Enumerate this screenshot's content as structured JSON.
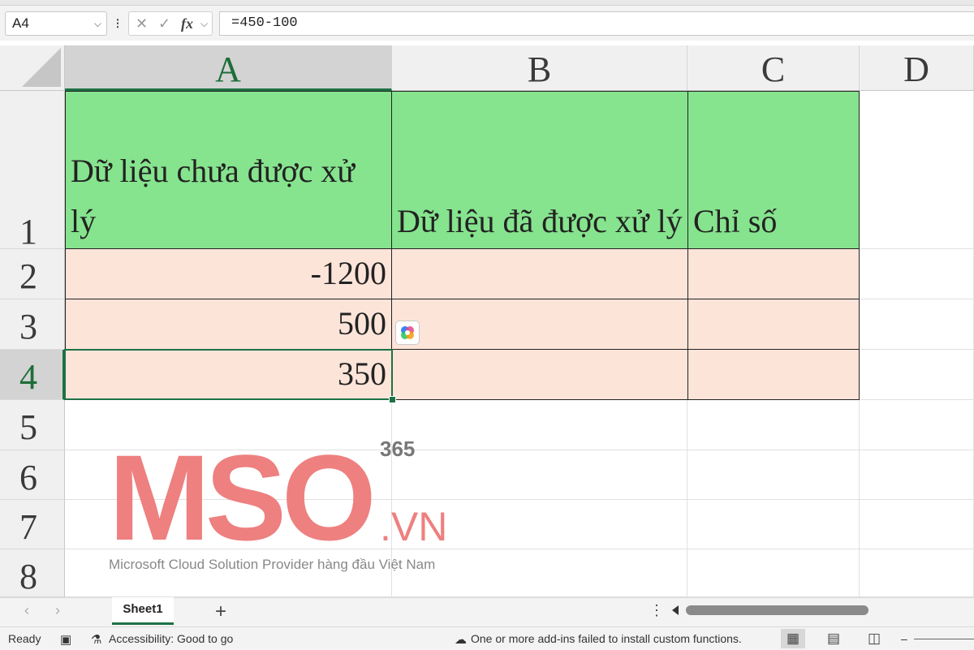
{
  "formula_bar": {
    "name_box": "A4",
    "menu_glyph": "⁝",
    "cancel_glyph": "✕",
    "enter_glyph": "✓",
    "fx_label": "fx",
    "formula": "=450-100"
  },
  "columns": [
    "A",
    "B",
    "C",
    "D"
  ],
  "rows": [
    "1",
    "2",
    "3",
    "4",
    "5",
    "6",
    "7",
    "8"
  ],
  "cells": {
    "A1": "Dữ liệu chưa được xử lý",
    "B1": "Dữ liệu đã được xử lý",
    "C1": "Chỉ số",
    "A2": "-1200",
    "A3": "500",
    "A4": "350"
  },
  "watermark": {
    "logo": "MSO",
    "superscript": "365",
    "suffix": ".VN",
    "tagline": "Microsoft Cloud Solution Provider hàng đầu Việt Nam"
  },
  "sheet_tabs": {
    "prev_glyph": "‹",
    "next_glyph": "›",
    "active_sheet": "Sheet1",
    "add_glyph": "+",
    "menu_glyph": "⋮"
  },
  "status_bar": {
    "ready": "Ready",
    "accessibility": "Accessibility: Good to go",
    "addins_message": "One or more add-ins failed to install custom functions.",
    "zoom_minus": "–"
  },
  "colors": {
    "header_fill": "#86e38e",
    "data_fill": "#fce4d9",
    "selection_green": "#1e7145",
    "watermark_red": "#ee8080"
  },
  "icons": [
    "chevron-down-icon",
    "cancel-icon",
    "enter-icon",
    "fx-icon",
    "copilot-icon",
    "macro-icon",
    "accessibility-icon",
    "addin-warning-icon",
    "normal-view-icon",
    "page-layout-icon",
    "page-break-icon"
  ]
}
